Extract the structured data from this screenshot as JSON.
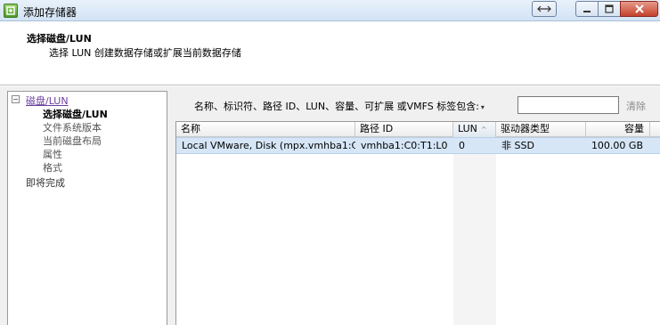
{
  "window": {
    "title": "添加存储器",
    "icon": "storage-add-icon",
    "buttons": [
      "restore-icon",
      "minimize-icon",
      "maximize-icon",
      "close-icon"
    ]
  },
  "header": {
    "title": "选择磁盘/LUN",
    "subtitle": "选择 LUN 创建数据存储或扩展当前数据存储"
  },
  "nav": {
    "toggle": "−",
    "items": [
      {
        "label": "磁盘/LUN",
        "state": "link"
      },
      {
        "label": "选择磁盘/LUN",
        "state": "current"
      },
      {
        "label": "文件系统版本",
        "state": "pending"
      },
      {
        "label": "当前磁盘布局",
        "state": "pending"
      },
      {
        "label": "属性",
        "state": "pending"
      },
      {
        "label": "格式",
        "state": "pending"
      },
      {
        "label": "即将完成",
        "state": "normal"
      }
    ]
  },
  "filter": {
    "label": "名称、标识符、路径 ID、LUN、容量、可扩展 或VMFS 标签包含:",
    "dropdown_glyph": "▾",
    "value": "",
    "clear_label": "清除"
  },
  "table": {
    "columns": [
      {
        "label": "名称"
      },
      {
        "label": "路径 ID"
      },
      {
        "label": "LUN",
        "sort": "^"
      },
      {
        "label": "驱动器类型"
      },
      {
        "label": "容量"
      }
    ],
    "rows": [
      {
        "name": "Local VMware, Disk (mpx.vmhba1:C...",
        "path_id": "vmhba1:C0:T1:L0",
        "lun": "0",
        "drive_type": "非 SSD",
        "capacity": "100.00 GB",
        "selected": true
      }
    ]
  },
  "colors": {
    "selected_row": "#d6e6f7",
    "link": "#6b3fa0",
    "close_button": "#c4412c"
  }
}
